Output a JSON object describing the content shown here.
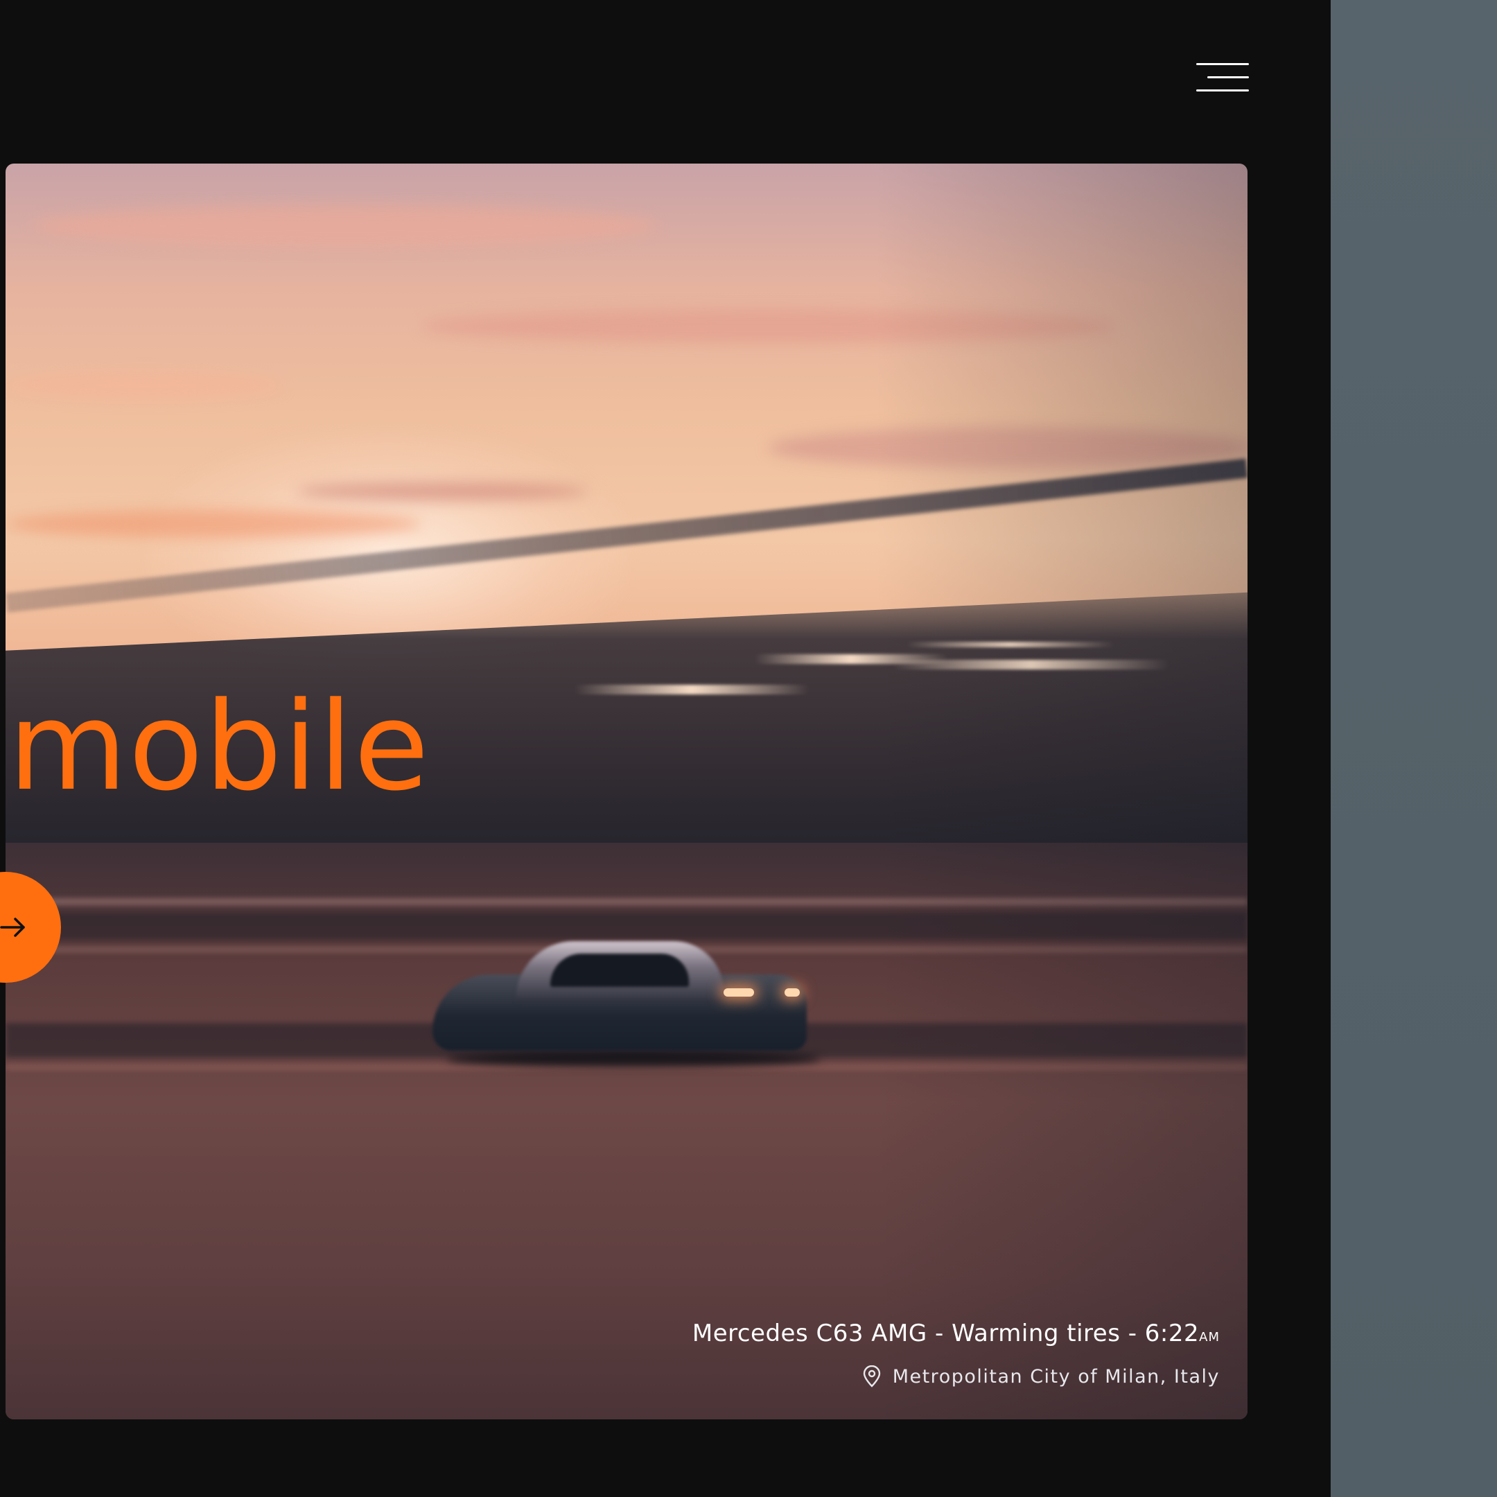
{
  "header": {
    "menu_icon": "hamburger-menu-icon"
  },
  "hero": {
    "headline": "mobile",
    "cta_icon": "arrow-right-icon",
    "caption_title": "Mercedes C63 AMG - Warming tires - 6:22",
    "caption_ampm": "AM",
    "location": "Metropolitan City of Milan, Italy",
    "location_icon": "map-pin-icon"
  },
  "colors": {
    "accent": "#ff6f0f",
    "background": "#0e0e0f",
    "side_panel": "#56626a",
    "text": "#ffffff"
  }
}
